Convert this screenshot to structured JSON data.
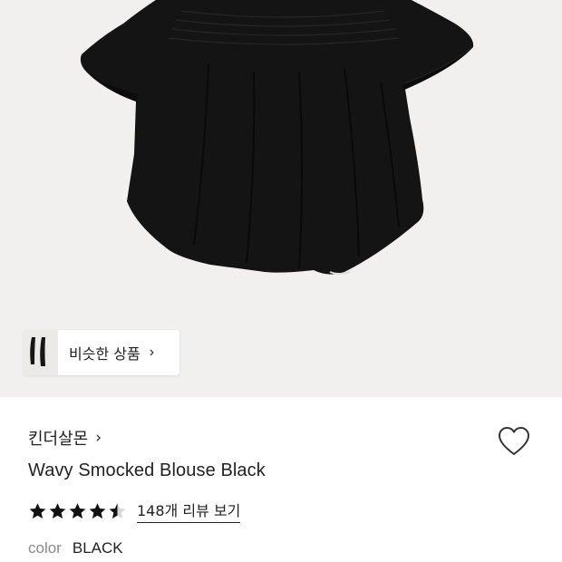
{
  "similar": {
    "label": "비슷한 상품",
    "arrow": "›"
  },
  "product": {
    "brand": "킨더살몬",
    "brand_arrow": "›",
    "title": "Wavy Smocked Blouse Black",
    "rating": 4.5,
    "stars_total": 5,
    "review_link": "148개 리뷰 보기",
    "color_label": "color",
    "color_value": "BLACK"
  },
  "icons": {
    "wishlist": "heart-outline-icon",
    "star": "star-icon"
  },
  "colors": {
    "hero_bg": "#f1f0ee",
    "garment": "#141414",
    "text": "#222222",
    "muted": "#8a8a8a"
  }
}
